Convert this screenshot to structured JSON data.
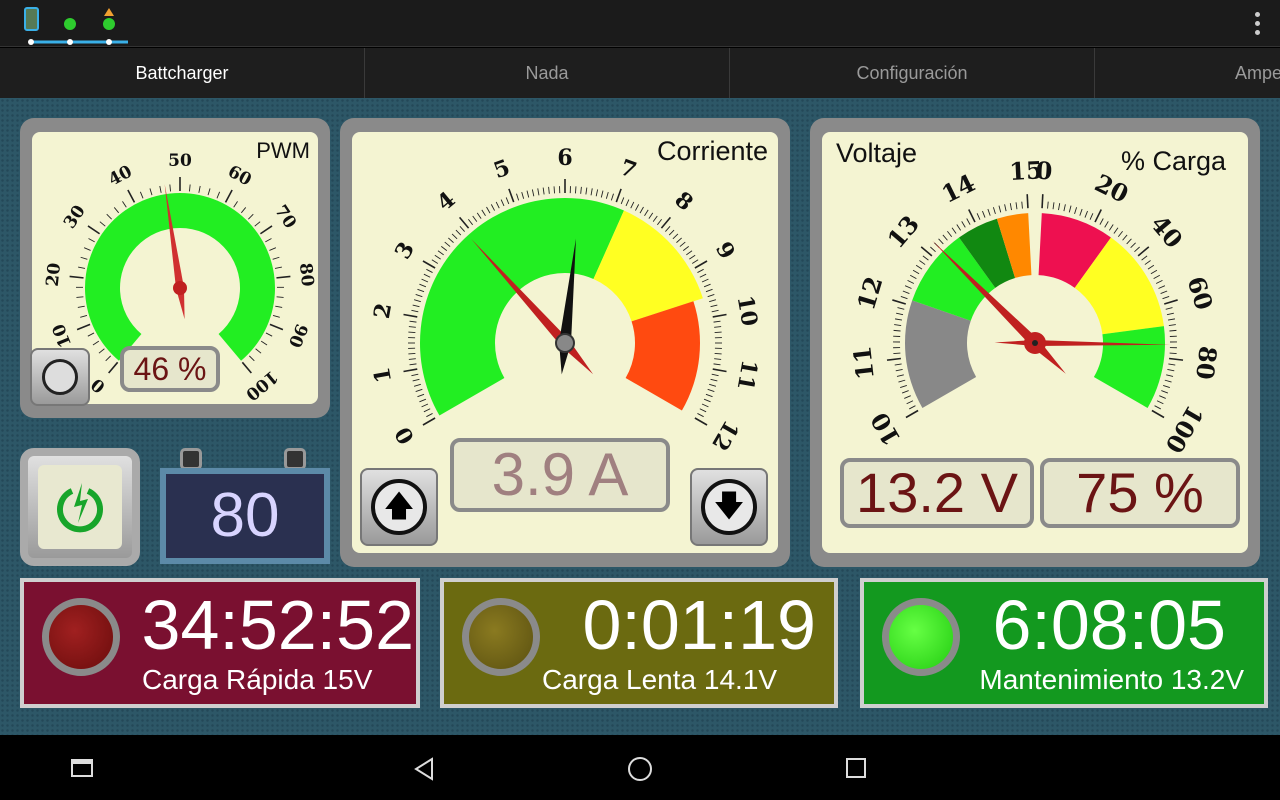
{
  "status_bar": {
    "icons": [
      "phone-icon",
      "android-icon",
      "bluetooth-icon",
      "warning-icon"
    ],
    "menu": "overflow-menu-icon"
  },
  "tabs": [
    {
      "label": "Battcharger",
      "active": true
    },
    {
      "label": "Nada"
    },
    {
      "label": "Configuración"
    },
    {
      "label": "Ampe"
    }
  ],
  "pwm": {
    "title": "PWM",
    "value": "46 %",
    "needle": 47,
    "scale": {
      "min": 0,
      "max": 100,
      "labels": [
        0,
        10,
        20,
        30,
        40,
        50,
        60,
        70,
        80,
        90,
        100
      ]
    },
    "bands": [
      {
        "from": 0,
        "to": 100,
        "color": "#22ee22"
      }
    ]
  },
  "current": {
    "title": "Corriente",
    "value": "3.9 A",
    "needle": 3.9,
    "setpoint": 6.3,
    "scale": {
      "min": 0,
      "max": 12,
      "labels": [
        0,
        1,
        2,
        3,
        4,
        5,
        6,
        7,
        8,
        9,
        10,
        11,
        12
      ]
    },
    "bands": [
      {
        "from": 0,
        "to": 7.2,
        "color": "#22ee22"
      },
      {
        "from": 7.2,
        "to": 9.6,
        "color": "#ffff22"
      },
      {
        "from": 9.6,
        "to": 12,
        "color": "#ff4a10"
      }
    ],
    "up_icon": "arrow-up-icon",
    "down_icon": "arrow-down-icon"
  },
  "voltage": {
    "title_left": "Voltaje",
    "title_right": "% Carga",
    "voltage_value": "13.2 V",
    "charge_value": "75 %",
    "voltage_needle": 13.2,
    "charge_needle": 75,
    "voltage_scale": {
      "min": 10,
      "max": 15,
      "labels": [
        10,
        11,
        12,
        13,
        14,
        15
      ]
    },
    "charge_scale": {
      "min": 0,
      "max": 100,
      "labels": [
        0,
        20,
        40,
        60,
        80,
        100
      ]
    },
    "voltage_bands": [
      {
        "from": 10,
        "to": 12.1,
        "color": "#888888"
      },
      {
        "from": 12.1,
        "to": 13.6,
        "color": "#22ee22"
      },
      {
        "from": 13.6,
        "to": 14.4,
        "color": "#118811"
      },
      {
        "from": 14.4,
        "to": 15,
        "color": "#ff8800"
      }
    ],
    "charge_bands": [
      {
        "from": 0,
        "to": 28,
        "color": "#ee1050"
      },
      {
        "from": 28,
        "to": 68,
        "color": "#ffff22"
      },
      {
        "from": 68,
        "to": 100,
        "color": "#22ee22"
      }
    ]
  },
  "power_button": {
    "icon": "power-charge-icon"
  },
  "battery": {
    "value": "80"
  },
  "timers": [
    {
      "time": "34:52:52",
      "label": "Carga Rápida 15V",
      "bg": "#7a1030",
      "led": "#7a1010"
    },
    {
      "time": "0:01:19",
      "label": "Carga Lenta 14.1V",
      "bg": "#6b6a10",
      "led": "#6b6010"
    },
    {
      "time": "6:08:05",
      "label": "Mantenimiento 13.2V",
      "bg": "#13991f",
      "led": "#33ee22"
    }
  ],
  "nav": [
    "recents-icon",
    "back-icon",
    "home-icon",
    "overview-icon"
  ]
}
